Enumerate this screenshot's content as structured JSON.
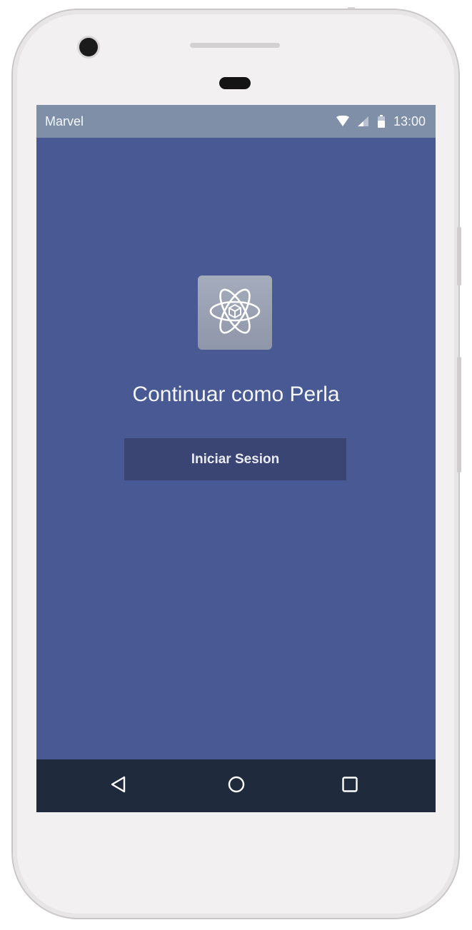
{
  "status_bar": {
    "carrier": "Marvel",
    "time": "13:00",
    "icons": [
      "wifi-icon",
      "signal-icon",
      "battery-icon"
    ]
  },
  "main": {
    "app_icon": "atom-icon",
    "headline": "Continuar como Perla",
    "login_button_label": "Iniciar Sesion"
  },
  "nav_bar": {
    "icons": [
      "back-icon",
      "home-icon",
      "recents-icon"
    ]
  },
  "colors": {
    "screen_background": "#485993",
    "status_bar": "#7f8fa8",
    "button": "#3a4574",
    "nav_bar": "#1f2b3c",
    "device_body": "#f2f0f1"
  }
}
